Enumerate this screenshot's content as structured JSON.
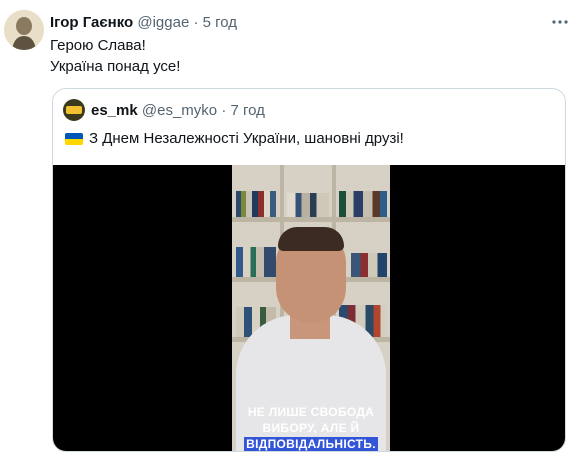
{
  "tweet": {
    "author_name": "Ігор Гаєнко",
    "handle": "@iggae",
    "separator": "·",
    "time": "5 год",
    "text_lines": [
      "Герою Слава!",
      "Україна понад усе!"
    ],
    "more_icon": "ellipsis-icon"
  },
  "quoted": {
    "author_name": "es_mk",
    "handle": "@es_myko",
    "separator": "·",
    "time": "7 год",
    "flag_emoji": "ukraine-flag-icon",
    "text": "З Днем Незалежності України, шановні друзі!",
    "video_caption_lines": [
      "НЕ ЛИШЕ СВОБОДА",
      "ВИБОРУ, АЛЕ Й",
      "ВІДПОВІДАЛЬНІСТЬ."
    ]
  },
  "colors": {
    "text": "#0f1419",
    "muted": "#536471",
    "border": "#cfd9de",
    "flag_blue": "#0057b7",
    "flag_yellow": "#ffd700",
    "caption_highlight": "#3355d8"
  }
}
